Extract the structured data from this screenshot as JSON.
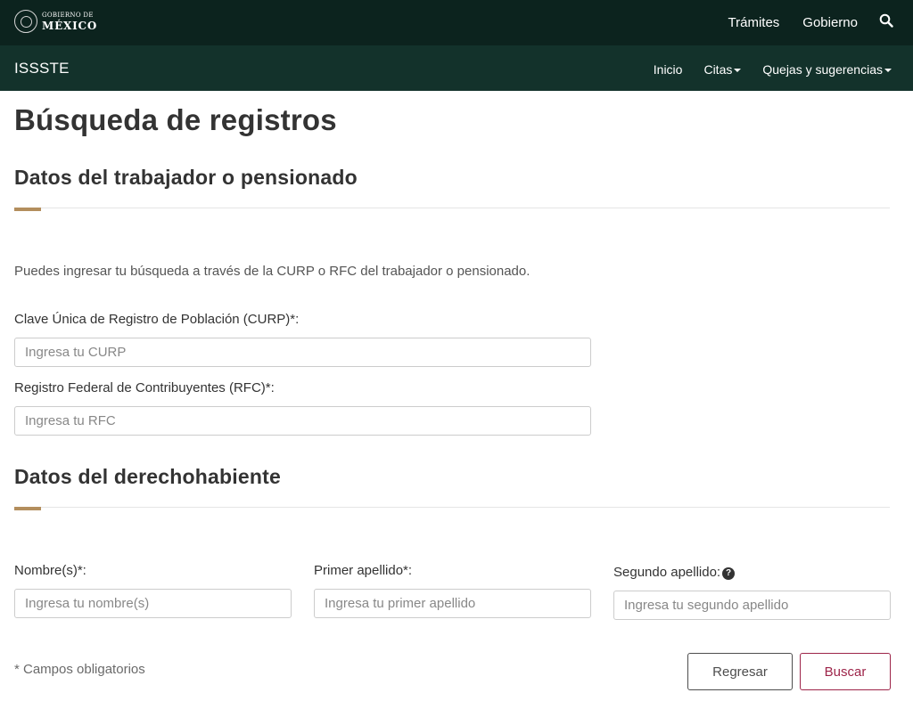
{
  "topbar": {
    "logo_line1": "GOBIERNO DE",
    "logo_line2": "MÉXICO",
    "links": [
      "Trámites",
      "Gobierno"
    ]
  },
  "subnav": {
    "brand": "ISSSTE",
    "links": [
      "Inicio",
      "Citas",
      "Quejas y sugerencias"
    ]
  },
  "page": {
    "title": "Búsqueda de registros"
  },
  "worker_section": {
    "title": "Datos del trabajador o pensionado",
    "help_text": "Puedes ingresar tu búsqueda a través de la CURP o RFC del trabajador o pensionado.",
    "curp_label": "Clave Única de Registro de Población (CURP)*:",
    "curp_placeholder": "Ingresa tu CURP",
    "curp_value": "",
    "rfc_label": "Registro Federal de Contribuyentes (RFC)*:",
    "rfc_placeholder": "Ingresa tu RFC",
    "rfc_value": ""
  },
  "beneficiary_section": {
    "title": "Datos del derechohabiente",
    "name_label": "Nombre(s)*:",
    "name_placeholder": "Ingresa tu nombre(s)",
    "first_surname_label": "Primer apellido*:",
    "first_surname_placeholder": "Ingresa tu primer apellido",
    "second_surname_label": "Segundo apellido:",
    "second_surname_placeholder": "Ingresa tu segundo apellido",
    "help_icon_glyph": "?"
  },
  "footer": {
    "required_note": "* Campos obligatorios",
    "back_label": "Regresar",
    "search_label": "Buscar"
  },
  "colors": {
    "topbar": "#0c231e",
    "subnav": "#13322b",
    "accent": "#b38e5d",
    "primary_button": "#9d2449"
  }
}
